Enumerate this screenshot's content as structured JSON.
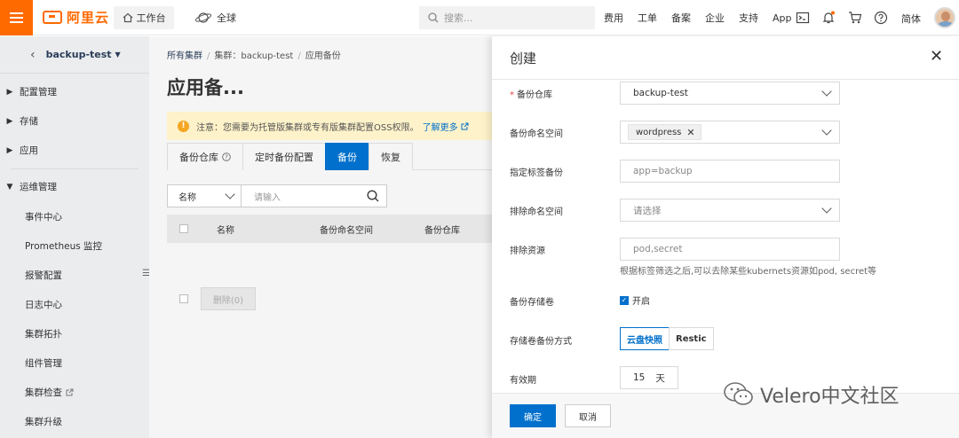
{
  "topbar": {
    "brand": "阿里云",
    "workbench": "工作台",
    "global": "全球",
    "search_placeholder": "搜索...",
    "links": [
      "费用",
      "工单",
      "备案",
      "企业",
      "支持",
      "App"
    ],
    "language": "简体",
    "brand_color": "#ff6a00"
  },
  "sidebar": {
    "cluster": "backup-test",
    "groups": [
      {
        "label": "配置管理"
      },
      {
        "label": "存储"
      },
      {
        "label": "应用"
      },
      {
        "label": "运维管理"
      }
    ],
    "ops_items": [
      {
        "label": "事件中心"
      },
      {
        "label": "Prometheus 监控"
      },
      {
        "label": "报警配置"
      },
      {
        "label": "日志中心"
      },
      {
        "label": "集群拓扑"
      },
      {
        "label": "组件管理"
      },
      {
        "label": "集群检查"
      },
      {
        "label": "集群升级"
      }
    ]
  },
  "main": {
    "breadcrumb": [
      "所有集群",
      "集群：backup-test",
      "应用备份"
    ],
    "title": "应用备...",
    "notice": "注意：您需要为托管版集群或专有版集群配置OSS权限。",
    "notice_link": "了解更多",
    "tabs": [
      {
        "label": "备份仓库"
      },
      {
        "label": "定时备份配置"
      },
      {
        "label": "备份"
      },
      {
        "label": "恢复"
      }
    ],
    "active_tab": "备份",
    "filter_field": "名称",
    "filter_placeholder": "请输入",
    "columns": [
      "名称",
      "备份命名空间",
      "备份仓库"
    ],
    "delete_button": "删除(0)"
  },
  "drawer": {
    "title": "创建",
    "fields": {
      "repo": {
        "label": "备份仓库",
        "value": "backup-test"
      },
      "namespace": {
        "label": "备份命名空间",
        "tag": "wordpress"
      },
      "labels": {
        "label": "指定标签备份",
        "placeholder": "app=backup"
      },
      "exclude_ns": {
        "label": "排除命名空间",
        "placeholder": "请选择"
      },
      "exclude_res": {
        "label": "排除资源",
        "placeholder": "pod,secret",
        "hint": "根据标签筛选之后,可以去除某些kubernets资源如pod, secret等"
      },
      "volumes": {
        "label": "备份存储卷",
        "checkbox": "开启"
      },
      "method": {
        "label": "存储卷备份方式",
        "options": [
          "云盘快照",
          "Restic"
        ],
        "selected": "云盘快照"
      },
      "ttl": {
        "label": "有效期",
        "value": "15",
        "unit": "天"
      }
    },
    "ok": "确定",
    "cancel": "取消",
    "accent": "#0070cc"
  },
  "watermark": "Velero中文社区"
}
